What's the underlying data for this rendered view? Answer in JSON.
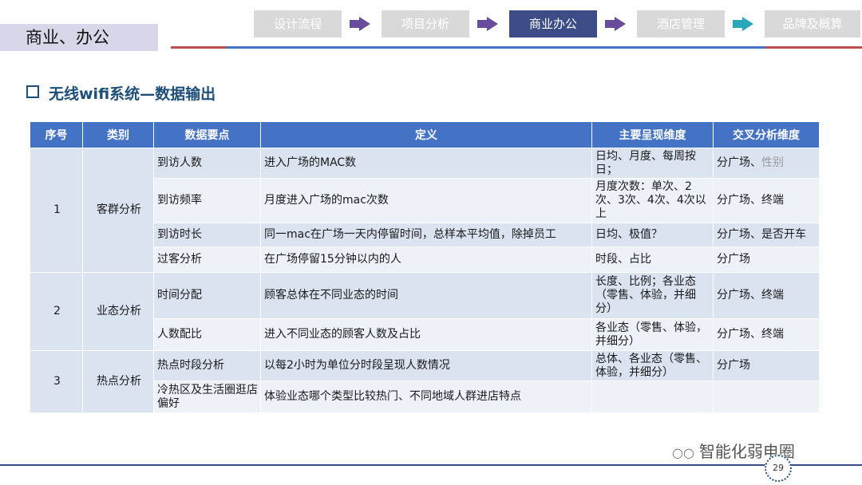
{
  "section_label": "商业、办公",
  "nav": [
    "设计流程",
    "项目分析",
    "商业办公",
    "酒店管理",
    "品牌及概算"
  ],
  "nav_active_index": 2,
  "title": "无线wifi系统—数据输出",
  "table": {
    "headers": [
      "序号",
      "类别",
      "数据要点",
      "定义",
      "主要呈现维度",
      "交叉分析维度"
    ],
    "groups": [
      {
        "no": "1",
        "category": "客群分析",
        "rows": [
          {
            "point": "到访人数",
            "definition": "进入广场的MAC数",
            "dimension": "日均、月度、每周按日；",
            "cross": "分广场、",
            "cross_muted": "性别"
          },
          {
            "point": "到访频率",
            "definition": "月度进入广场的mac次数",
            "dimension": "月度次数：单次、2次、3次、4次、4次以上",
            "cross": "分广场、终端"
          },
          {
            "point": "到访时长",
            "definition": "同一mac在广场一天内停留时间，总样本平均值，除掉员工",
            "dimension": "日均、极值？",
            "cross": "分广场、是否开车"
          },
          {
            "point": "过客分析",
            "definition": "在广场停留15分钟以内的人",
            "dimension": "时段、占比",
            "cross": "分广场"
          }
        ]
      },
      {
        "no": "2",
        "category": "业态分析",
        "rows": [
          {
            "point": "时间分配",
            "definition": "顾客总体在不同业态的时间",
            "dimension": "长度、比例；各业态（零售、体验，并细分）",
            "cross": "分广场、终端"
          },
          {
            "point": "人数配比",
            "definition": "进入不同业态的顾客人数及占比",
            "dimension": "各业态（零售、体验，并细分）",
            "cross": "分广场、终端"
          }
        ]
      },
      {
        "no": "3",
        "category": "热点分析",
        "rows": [
          {
            "point": "热点时段分析",
            "definition": "以每2小时为单位分时段呈现人数情况",
            "dimension": "总体、各业态（零售、体验，并细分）",
            "cross": "分广场"
          },
          {
            "point": "冷热区及生活圈逛店偏好",
            "definition": "体验业态哪个类型比较热门、不同地域人群进店特点",
            "dimension": "",
            "cross": ""
          }
        ]
      }
    ]
  },
  "watermark": "智能化弱电圈",
  "page_number": "29",
  "colors": {
    "header": "#4472c4",
    "active_nav": "#3b4c86",
    "row_dark": "#dbe3f1",
    "row_light": "#edf1f8",
    "title": "#1f4e79"
  }
}
